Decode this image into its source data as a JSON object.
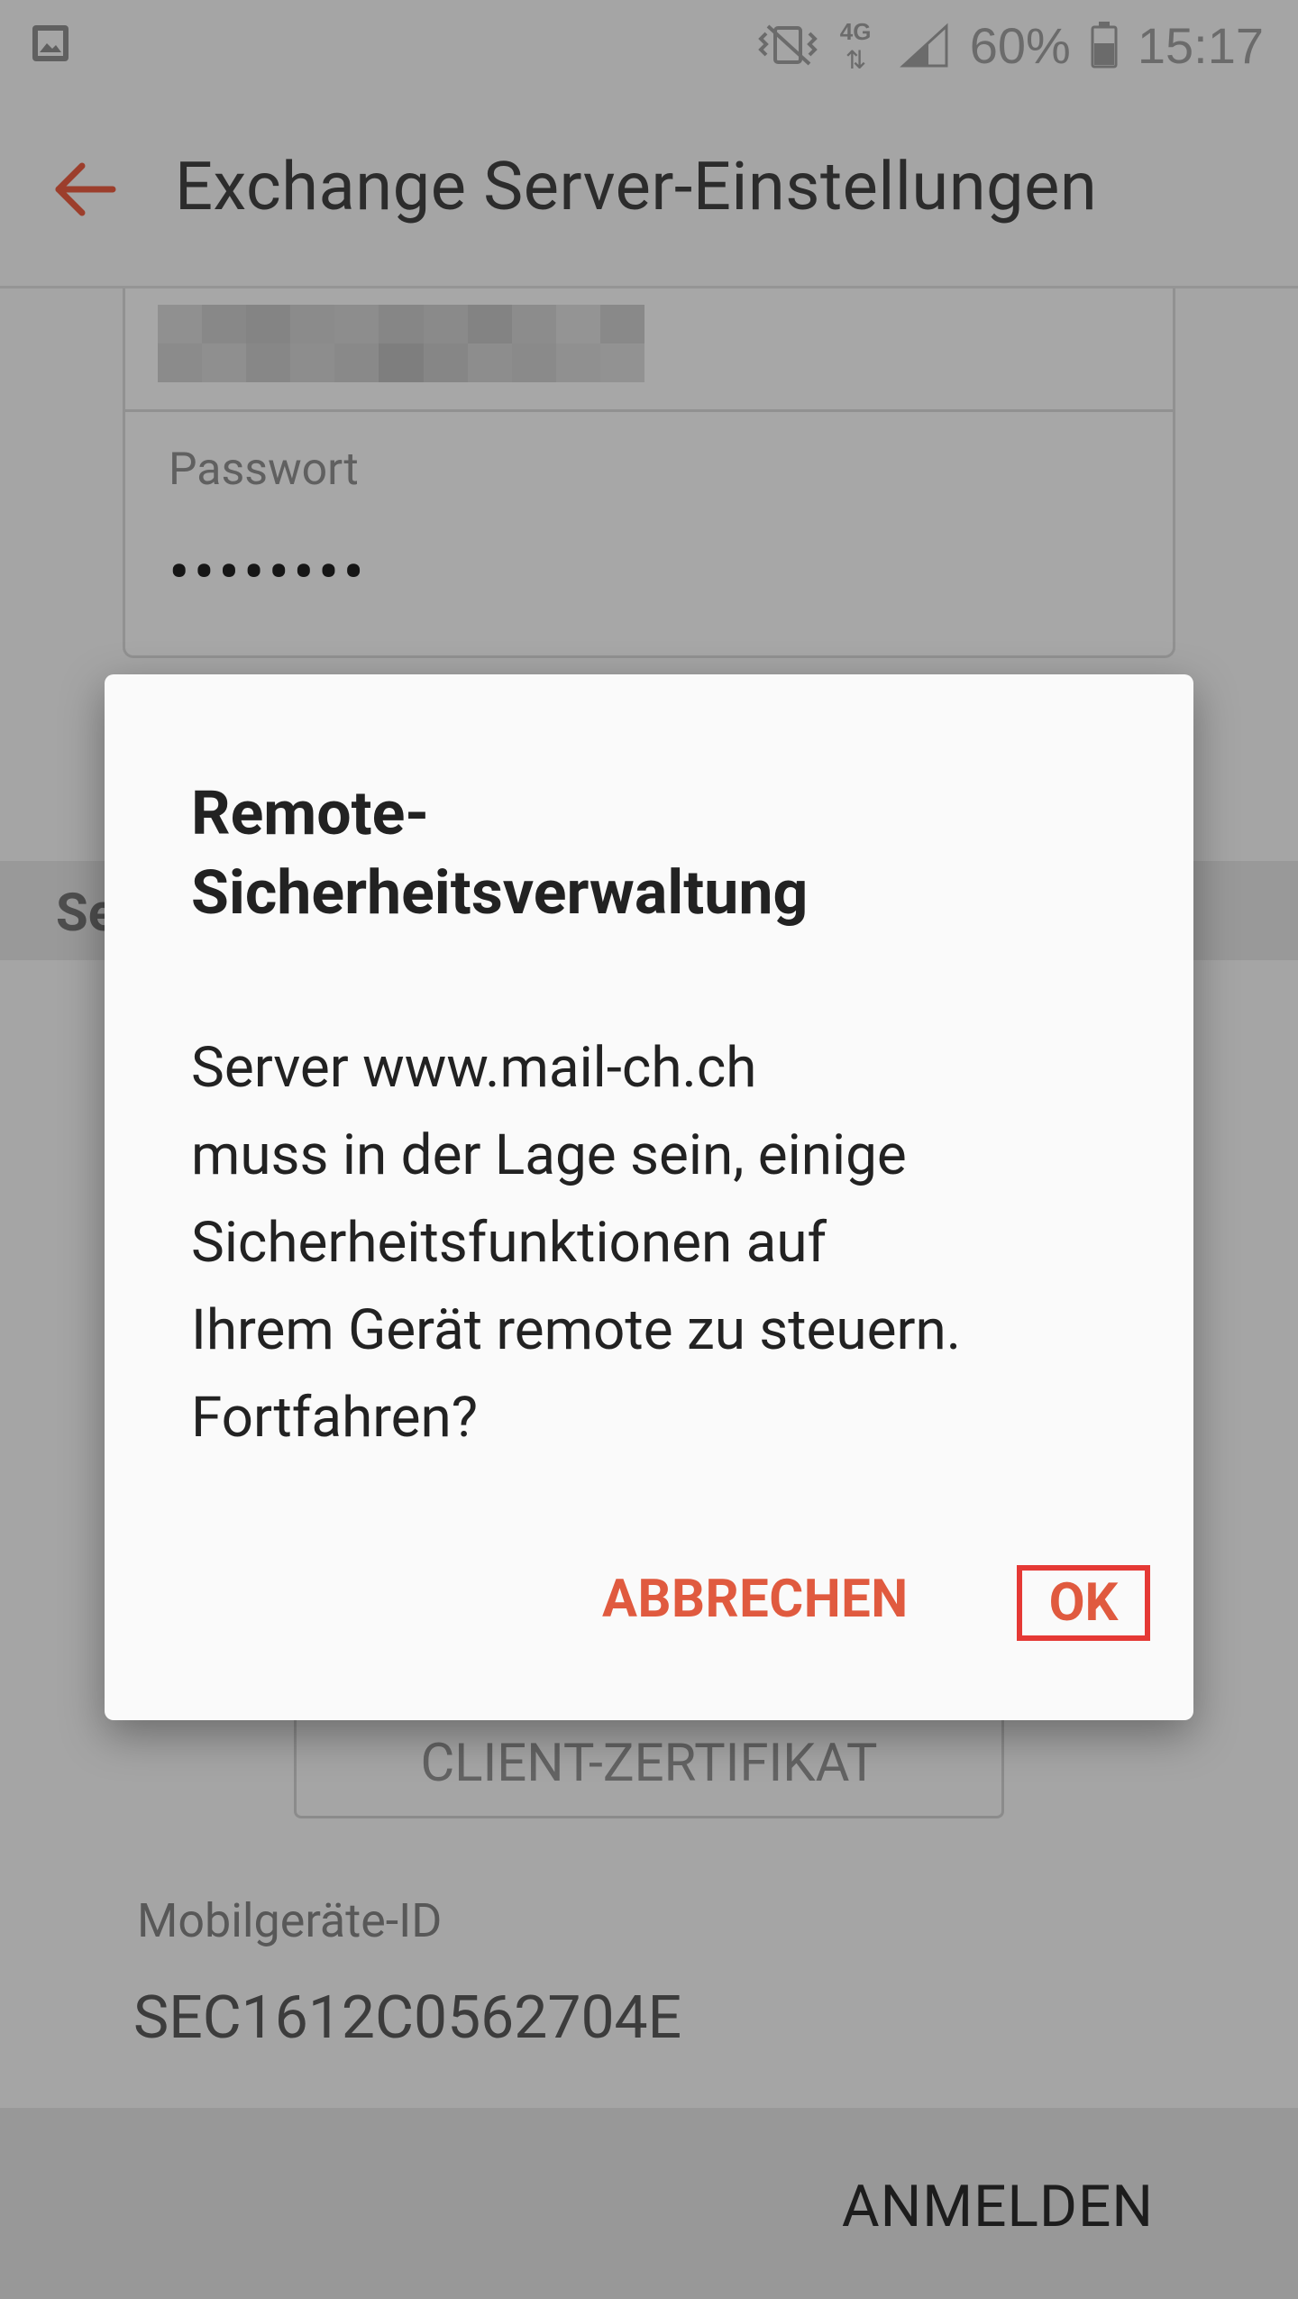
{
  "status_bar": {
    "battery_percent": "60%",
    "time": "15:17",
    "network_label": "4G"
  },
  "app_bar": {
    "title": "Exchange Server-Einstellungen"
  },
  "form": {
    "password_label": "Passwort",
    "password_value": "••••••••"
  },
  "section": {
    "partial_header": "Se"
  },
  "client_cert_button": "CLIENT-ZERTIFIKAT",
  "device": {
    "label": "Mobilgeräte-ID",
    "id": "SEC1612C0562704E"
  },
  "bottom": {
    "login_label": "ANMELDEN"
  },
  "dialog": {
    "title": "Remote-\nSicherheitsverwaltung",
    "message": "Server www.mail-ch.ch\nmuss in der Lage sein, einige\nSicherheitsfunktionen auf\nIhrem Gerät remote zu steuern.\nFortfahren?",
    "cancel_label": "ABBRECHEN",
    "ok_label": "OK"
  },
  "colors": {
    "accent": "#e05a3f",
    "highlight_border": "#e53935"
  },
  "icons": [
    "gallery-icon",
    "vibrate-icon",
    "network-4g-icon",
    "signal-icon",
    "battery-icon",
    "back-arrow-icon"
  ]
}
